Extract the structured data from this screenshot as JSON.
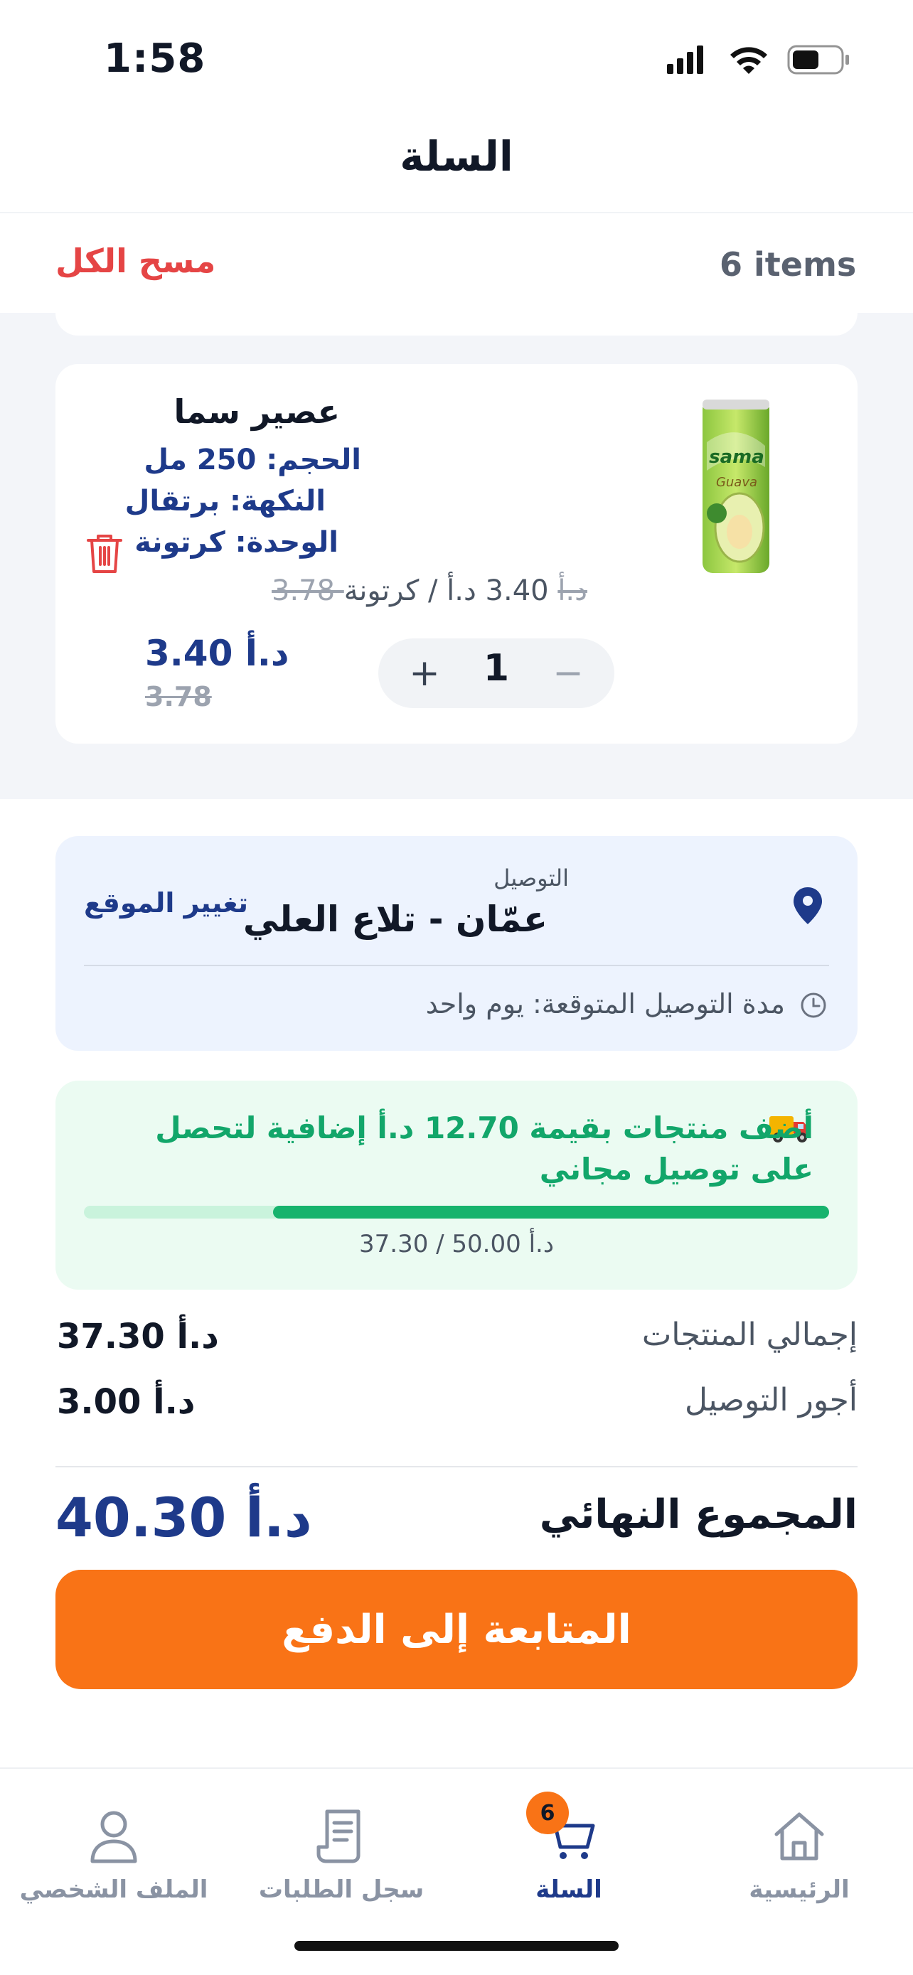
{
  "status_bar": {
    "time": "1:58"
  },
  "header": {
    "title": "السلة"
  },
  "cart_summary": {
    "items_count": "6 items",
    "clear_all": "مسح الكل"
  },
  "item": {
    "name": "عصير سما",
    "size": "الحجم: 250 مل",
    "flavor": "النكهة: برتقال",
    "unit": "الوحدة: كرتونة",
    "unit_price_current": "3.40 د.أ / كرتونة",
    "unit_price_old": "3.78 د.أ",
    "price": "3.40 د.أ",
    "price_old": "3.78",
    "quantity": "1",
    "image_brand": "sama",
    "image_flavor": "Guava"
  },
  "delivery": {
    "label": "التوصيل",
    "address": "عمّان - تلاع العلي",
    "change_location": "تغيير الموقع",
    "estimated_time": "مدة التوصيل المتوقعة: يوم واحد"
  },
  "free_delivery": {
    "message": "أضف منتجات بقيمة 12.70 د.أ إضافية لتحصل على توصيل مجاني",
    "progress_text": "37.30 / 50.00 د.أ",
    "progress_fraction": 0.746
  },
  "totals": {
    "subtotal_label": "إجمالي المنتجات",
    "subtotal_value": "37.30 د.أ",
    "delivery_fee_label": "أجور التوصيل",
    "delivery_fee_value": "3.00 د.أ",
    "grand_total_label": "المجموع النهائي",
    "grand_total_value": "40.30 د.أ"
  },
  "checkout": {
    "label": "المتابعة إلى الدفع"
  },
  "nav": {
    "home": "الرئيسية",
    "cart": "السلة",
    "cart_badge": "6",
    "orders": "سجل الطلبات",
    "profile": "الملف الشخصي"
  },
  "colors": {
    "primary": "#1e3a8a",
    "accent": "#f97316",
    "danger": "#e54545",
    "success": "#16b36d"
  }
}
